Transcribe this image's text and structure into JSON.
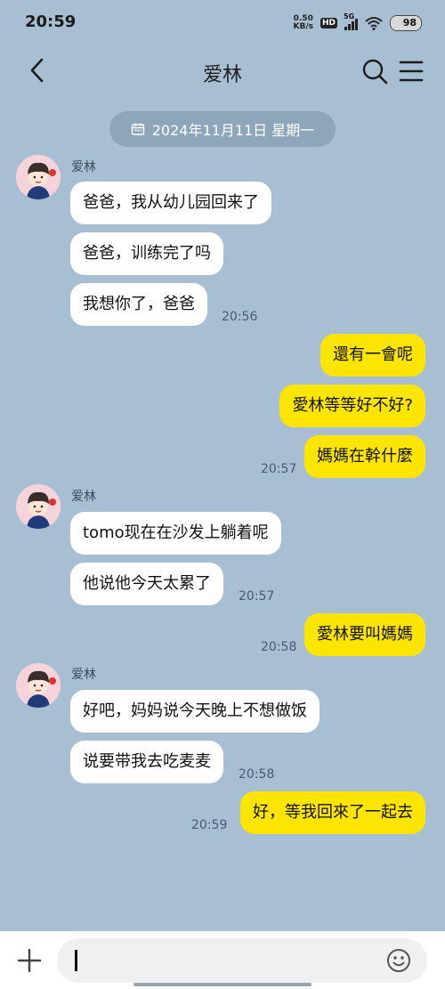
{
  "status_bar": {
    "time": "20:59",
    "speed_value": "0.50",
    "speed_unit": "KB/s",
    "hd": "HD",
    "network": "5G",
    "battery": "98",
    "battery_level": 0.98
  },
  "header": {
    "title": "爱林",
    "back_icon": "chevron-left-icon",
    "search_icon": "search-icon",
    "menu_icon": "hamburger-menu-icon"
  },
  "date_pill": {
    "icon": "calendar-icon",
    "text": "2024年11月11日 星期一"
  },
  "messages": {
    "g1_sender": "爱林",
    "g1_m1": "爸爸，我从幼儿园回来了",
    "g1_m2": "爸爸，训练完了吗",
    "g1_m3": "我想你了，爸爸",
    "g1_time": "20:56",
    "o1_m1": "還有一會呢",
    "o1_m2": "愛林等等好不好?",
    "o1_m3": "媽媽在幹什麼",
    "o1_time": "20:57",
    "g2_sender": "爱林",
    "g2_m1": "tomo现在在沙发上躺着呢",
    "g2_m2": "他说他今天太累了",
    "g2_time": "20:57",
    "o2_m1": "愛林要叫媽媽",
    "o2_time": "20:58",
    "g3_sender": "爱林",
    "g3_m1": "好吧，妈妈说今天晚上不想做饭",
    "g3_m2": "说要带我去吃麦麦",
    "g3_time": "20:58",
    "o3_m1": "好，等我回來了一起去",
    "o3_time": "20:59"
  },
  "input_bar": {
    "plus_icon": "plus-icon",
    "emoji_icon": "emoji-icon"
  },
  "colors": {
    "background": "#a8bfd3",
    "outgoing_bubble": "#fde502",
    "incoming_bubble": "#ffffff",
    "date_pill": "#8ea6bb"
  }
}
